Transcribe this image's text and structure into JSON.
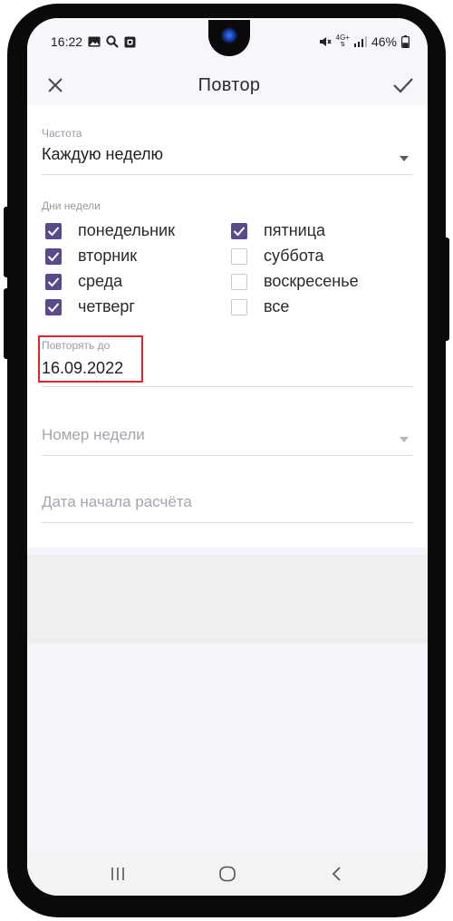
{
  "status_bar": {
    "time": "16:22",
    "left_icons": [
      "image-icon",
      "search-icon",
      "app-icon"
    ],
    "right_icons": [
      "mute-vibrate-icon",
      "4g-icon",
      "signal-icon"
    ],
    "network_label": "4G+",
    "battery_percent": "46%",
    "battery_level": 0.46
  },
  "app_bar": {
    "title": "Повтор",
    "close_icon": "close-icon",
    "confirm_icon": "check-icon"
  },
  "form": {
    "frequency": {
      "label": "Частота",
      "value": "Каждую неделю"
    },
    "weekdays": {
      "label": "Дни недели",
      "left_column": [
        {
          "label": "понедельник",
          "checked": true
        },
        {
          "label": "вторник",
          "checked": true
        },
        {
          "label": "среда",
          "checked": true
        },
        {
          "label": "четверг",
          "checked": true
        }
      ],
      "right_column": [
        {
          "label": "пятница",
          "checked": true
        },
        {
          "label": "суббота",
          "checked": false
        },
        {
          "label": "воскресенье",
          "checked": false
        },
        {
          "label": "все",
          "checked": false
        }
      ]
    },
    "repeat_until": {
      "label": "Повторять до",
      "value": "16.09.2022"
    },
    "week_number": {
      "placeholder": "Номер недели"
    },
    "calc_start_date": {
      "placeholder": "Дата начала расчёта"
    }
  },
  "nav_bar": {
    "recents_icon": "recents-icon",
    "home_icon": "home-icon",
    "back_icon": "back-icon"
  },
  "colors": {
    "accent_checkbox": "#5b4a8a",
    "highlight": "#e0252b",
    "screen_bg": "#f5f6fc"
  }
}
